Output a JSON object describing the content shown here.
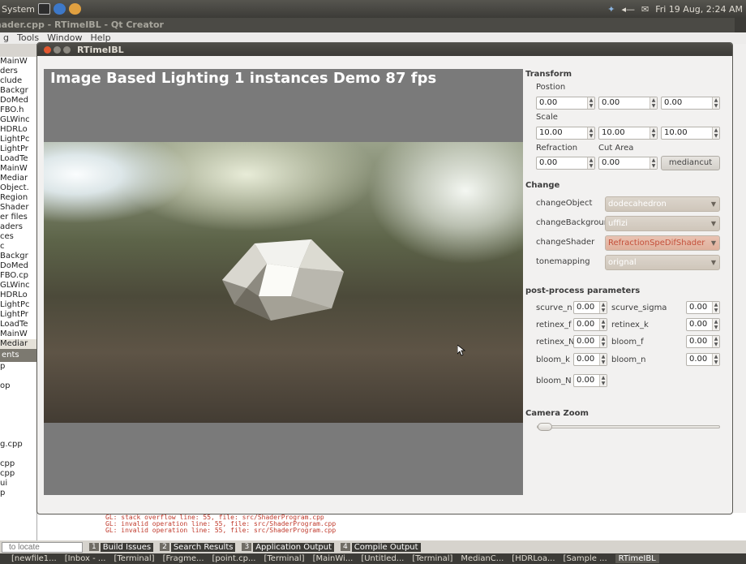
{
  "top_panel": {
    "system_menu": "System",
    "clock": "Fri 19 Aug,  2:24 AM"
  },
  "qt": {
    "title": "Shader.cpp - RTimeIBL - Qt Creator",
    "menus": [
      "g",
      "Tools",
      "Window",
      "Help"
    ],
    "files_top": [
      "MainW",
      "ders",
      "clude",
      "Backgr",
      "DoMed",
      "FBO.h",
      "GLWinc",
      "HDRLo",
      "LightPc",
      "LightPr",
      "LoadTe",
      "MainW",
      "Mediar",
      "Object.",
      "Region",
      "Shader",
      "er files",
      "aders",
      "ces",
      "c",
      "Backgr",
      "DoMed",
      "FBO.cp",
      "GLWinc",
      "HDRLo",
      "LightPc",
      "LightPr",
      "LoadTe",
      "MainW",
      "Mediar"
    ],
    "open_documents_label": "ents",
    "files_bottom": [
      "p",
      "",
      "op",
      "",
      "",
      "",
      "",
      "",
      "g.cpp",
      "",
      "cpp",
      "cpp",
      "ui",
      "p"
    ],
    "console_lines": [
      "GL: stack overflow  line: 55, file: src/ShaderProgram.cpp",
      "GL: invalid operation  line: 55, file: src/ShaderProgram.cpp",
      "GL: invalid operation  line: 55, file: src/ShaderProgram.cpp"
    ],
    "locate_placeholder": "to locate",
    "panes": [
      {
        "num": "1",
        "label": "Build Issues"
      },
      {
        "num": "2",
        "label": "Search Results"
      },
      {
        "num": "3",
        "label": "Application Output"
      },
      {
        "num": "4",
        "label": "Compile Output"
      }
    ],
    "right_strip_label": "line:"
  },
  "taskbar": [
    "[newfile1...",
    "[Inbox - ...",
    "[Terminal]",
    "[Fragme...",
    "[point.cp...",
    "[Terminal]",
    "[MainWi...",
    "[Untitled...",
    "[Terminal]",
    "MedianC...",
    "[HDRLoa...",
    "[Sample ...",
    "RTimeIBL"
  ],
  "window": {
    "title": "RTimeIBL"
  },
  "viewport": {
    "overlay_text": "Image Based Lighting 1 instances Demo 87 fps"
  },
  "transform": {
    "heading": "Transform",
    "position_label": "Postion",
    "position": [
      "0.00",
      "0.00",
      "0.00"
    ],
    "scale_label": "Scale",
    "scale": [
      "10.00",
      "10.00",
      "10.00"
    ],
    "refraction_label": "Refraction",
    "cut_area_label": "Cut Area",
    "refraction": "0.00",
    "cut_area": "0.00",
    "mediancut_button": "mediancut"
  },
  "change": {
    "heading": "Change",
    "rows": [
      {
        "label": "changeObject",
        "value": "dodecahedron"
      },
      {
        "label": "changeBackground",
        "value": "uffizi"
      },
      {
        "label": "changeShader",
        "value": "RefractionSpeDifShader"
      },
      {
        "label": "tonemapping",
        "value": "orignal"
      }
    ]
  },
  "post": {
    "heading": "post-process parameters",
    "params": [
      {
        "label": "scurve_n",
        "value": "0.00"
      },
      {
        "label": "scurve_sigma",
        "value": "0.00"
      },
      {
        "label": "retinex_f",
        "value": "0.00"
      },
      {
        "label": "retinex_k",
        "value": "0.00"
      },
      {
        "label": "retinex_N",
        "value": "0.00"
      },
      {
        "label": "bloom_f",
        "value": "0.00"
      },
      {
        "label": "bloom_k",
        "value": "0.00"
      },
      {
        "label": "bloom_n",
        "value": "0.00"
      },
      {
        "label": "bloom_N",
        "value": "0.00"
      }
    ]
  },
  "camera": {
    "heading": "Camera Zoom",
    "zoom_fraction": 0.0
  },
  "colors": {
    "accent_combo": "#e0b09c",
    "combo": "#cfc6ba",
    "panel_bg": "#f2f1f0",
    "ubuntu_dark": "#3c3b37"
  }
}
